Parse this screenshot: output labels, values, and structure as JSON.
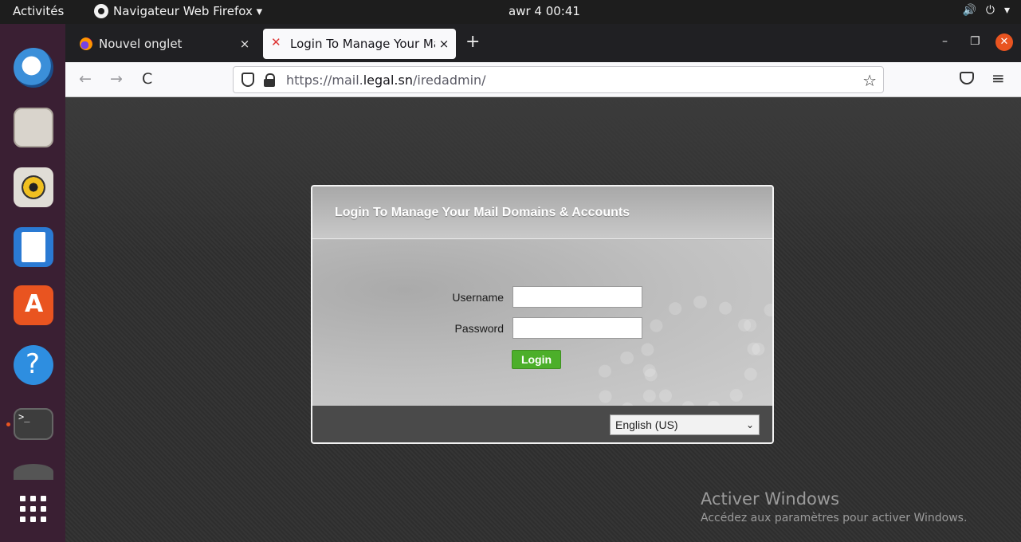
{
  "topbar": {
    "activities": "Activités",
    "app_name": "Navigateur Web Firefox ▾",
    "clock": "awr 4  00:41",
    "tray": {
      "volume_icon": "🔊",
      "power_icon": "⏻",
      "menu_icon": "▾"
    }
  },
  "dock": {
    "items": [
      "thunderbird-icon",
      "files-icon",
      "rhythmbox-icon",
      "writer-icon",
      "software-store-icon",
      "help-icon",
      "terminal-icon",
      "disk-icon",
      "app-grid-icon"
    ]
  },
  "browser": {
    "tabs": [
      {
        "title": "Nouvel onglet",
        "close": "×"
      },
      {
        "title": "Login To Manage Your Ma",
        "close": "×"
      }
    ],
    "new_tab": "+",
    "window": {
      "minimize": "–",
      "maximize": "❐",
      "close": "✕"
    },
    "nav": {
      "back": "←",
      "forward": "→",
      "reload": "C"
    },
    "url": {
      "prefix": "https://mail.",
      "domain": "legal.sn",
      "path": "/iredadmin/"
    },
    "bookmark_star": "☆",
    "menu": "≡"
  },
  "login": {
    "title": "Login To Manage Your Mail Domains & Accounts",
    "username_label": "Username",
    "password_label": "Password",
    "username_value": "",
    "password_value": "",
    "button": "Login",
    "language": "English (US)",
    "chevron": "⌄"
  },
  "watermark": {
    "line1": "Activer Windows",
    "line2": "Accédez aux paramètres pour activer Windows."
  },
  "colors": {
    "accent": "#e95420",
    "login_button": "#4caf2a"
  }
}
